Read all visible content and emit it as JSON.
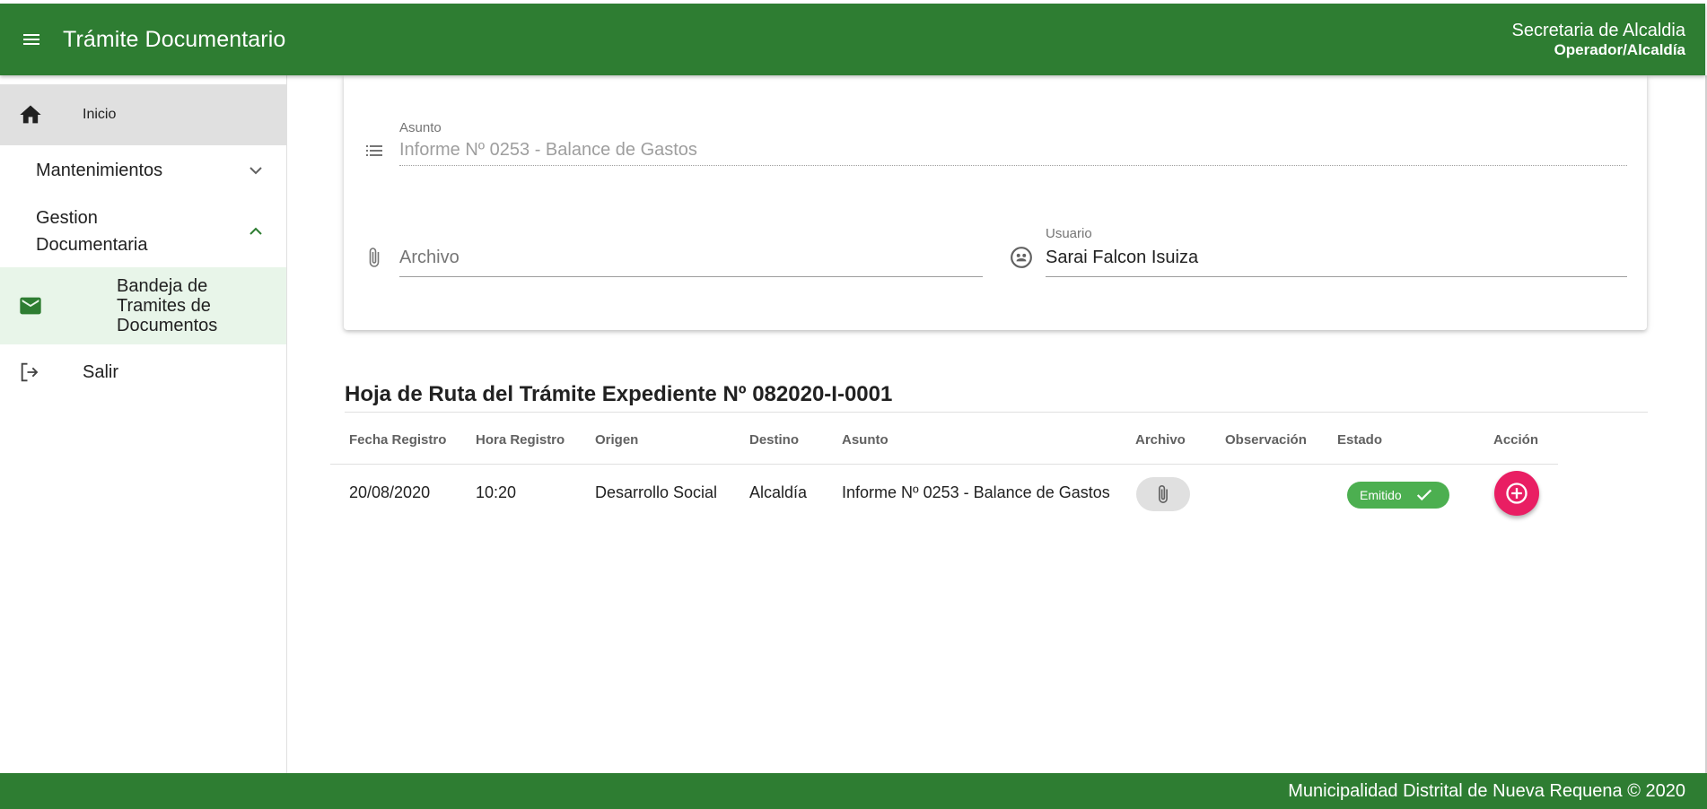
{
  "header": {
    "title": "Trámite Documentario",
    "user_name": "Secretaria de Alcaldia",
    "user_role": "Operador/Alcaldía",
    "menu_icon": "menu-icon"
  },
  "sidebar": {
    "home": {
      "label": "Inicio",
      "icon": "home-icon"
    },
    "maintenance": {
      "label": "Mantenimientos",
      "icon": "chevron-down-icon"
    },
    "doc_management": {
      "label": "Gestion Documentaria",
      "icon": "chevron-up-icon"
    },
    "inbox": {
      "label": "Bandeja de Tramites de Documentos",
      "icon": "mail-icon"
    },
    "exit": {
      "label": "Salir",
      "icon": "logout-icon"
    }
  },
  "form": {
    "subject_label": "Asunto",
    "subject_value": "Informe Nº 0253 - Balance de Gastos",
    "file_placeholder": "Archivo",
    "user_label": "Usuario",
    "user_value": "Sarai Falcon Isuiza"
  },
  "route": {
    "title": "Hoja de Ruta del Trámite Expediente Nº 082020-I-0001",
    "columns": [
      "Fecha Registro",
      "Hora Registro",
      "Origen",
      "Destino",
      "Asunto",
      "Archivo",
      "Observación",
      "Estado",
      "Acción"
    ],
    "rows": [
      {
        "fecha": "20/08/2020",
        "hora": "10:20",
        "origen": "Desarrollo Social",
        "destino": "Alcaldía",
        "asunto": "Informe Nº 0253 - Balance de Gastos",
        "observacion": "",
        "estado": "Emitido"
      }
    ]
  },
  "footer": {
    "text": "Municipalidad Distrital de Nueva Requena © 2020"
  },
  "colors": {
    "primary": "#2e7d32",
    "accent": "#e91e63",
    "success": "#4caf50",
    "selected_bg": "#e8f5e9"
  }
}
